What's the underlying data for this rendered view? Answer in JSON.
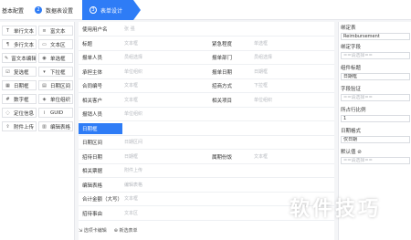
{
  "steps": {
    "step1": "基本配置",
    "step2": "数据表设置",
    "step2_num": "2",
    "step3": "表单设计",
    "step3_num": "3"
  },
  "palette": [
    {
      "icon": "T",
      "label": "单行文本"
    },
    {
      "icon": "≡",
      "label": "富文本"
    },
    {
      "icon": "¶",
      "label": "多行文本"
    },
    {
      "icon": "▭",
      "label": "文本区"
    },
    {
      "icon": "✎",
      "label": "富文本编辑"
    },
    {
      "icon": "◉",
      "label": "单选框"
    },
    {
      "icon": "☑",
      "label": "复选框"
    },
    {
      "icon": "▾",
      "label": "下拉框"
    },
    {
      "icon": "▦",
      "label": "日期框"
    },
    {
      "icon": "▤",
      "label": "日期区间"
    },
    {
      "icon": "#",
      "label": "数字框"
    },
    {
      "icon": "◈",
      "label": "单位组织"
    },
    {
      "icon": "◌",
      "label": "定位信息"
    },
    {
      "icon": "i",
      "label": "GUID"
    },
    {
      "icon": "⇪",
      "label": "附件上传"
    },
    {
      "icon": "▥",
      "label": "编辑表格"
    }
  ],
  "form": {
    "rows": [
      {
        "c1": "使用用户名",
        "p1": "张 强"
      },
      {
        "c1": "标题",
        "p1": "文本框",
        "c2": "紧急程度",
        "p2": "单选框"
      },
      {
        "c1": "报单人员",
        "p1": "员组选择",
        "c2": "报单部门",
        "p2": "员组选择"
      },
      {
        "c1": "承担主体",
        "p1": "单位组织",
        "c2": "报单日期",
        "p2": "日期框"
      },
      {
        "c1": "合同编号",
        "p1": "文本框",
        "c2": "招商方式",
        "p2": "下拉框"
      },
      {
        "c1": "相关客户",
        "p1": "文本框",
        "c2": "相关项目",
        "p2": "单位组织"
      },
      {
        "c1": "报销人员",
        "p1": "单位组织"
      },
      {
        "c1": "日期框",
        "selected": true
      },
      {
        "c1": "日期区间",
        "p1": "日期区间"
      },
      {
        "c1": "招待日期",
        "p1": "日期框",
        "c2": "属期份饭",
        "p2": "文本框"
      },
      {
        "c1": "相关票据",
        "p1": "附件上传"
      },
      {
        "c1": "编辑表格",
        "p1": "编辑表格"
      },
      {
        "c1": "合计金额（大写）",
        "p1": "文本框"
      },
      {
        "c1": "招待事由",
        "p1": "文本区"
      }
    ],
    "bottom_left": "⇲ 选项卡编辑",
    "bottom_right": "⊕ 新选表单"
  },
  "props": {
    "l1": "绑定表",
    "v1": "Reimbursement",
    "l2": "绑定字段",
    "v2": "==请选择==",
    "l3": "组件标题",
    "v3": "日期框",
    "l4": "字段验证",
    "v4": "==请选择==",
    "l5": "所占行比例",
    "v5": "1",
    "l6": "日期格式",
    "v6": "仅日期",
    "l7": "默认值 ⊘",
    "v7": "==请选择=="
  },
  "watermark": "软件技巧"
}
